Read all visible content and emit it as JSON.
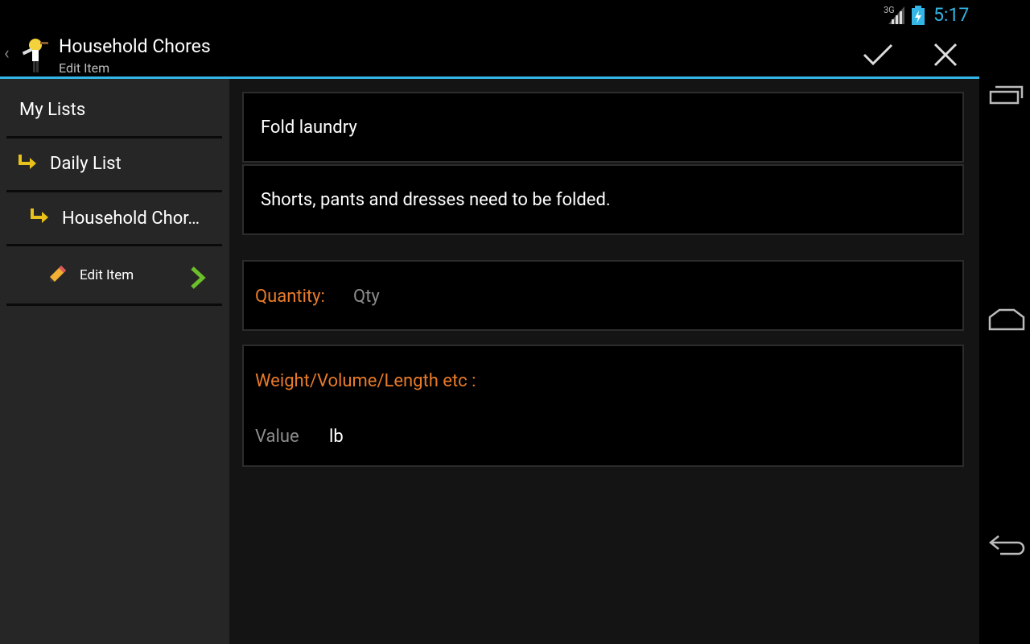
{
  "status_bar": {
    "network": "3G",
    "time": "5:17"
  },
  "action_bar": {
    "title": "Household Chores",
    "subtitle": "Edit Item"
  },
  "sidebar": {
    "items": [
      {
        "label": "My Lists"
      },
      {
        "label": "Daily List"
      },
      {
        "label": "Household Chor…"
      },
      {
        "label": "Edit Item"
      }
    ]
  },
  "form": {
    "item_name": "Fold laundry",
    "item_notes": "Shorts, pants and dresses need to be folded.",
    "quantity_label": "Quantity:",
    "quantity_placeholder": "Qty",
    "measure_label": "Weight/Volume/Length etc :",
    "value_placeholder": "Value",
    "unit": "lb"
  },
  "colors": {
    "accent": "#33b5e5",
    "label_orange": "#e87b2a",
    "nav_arrow": "#6abf2a",
    "tree_arrow": "#e8c21a"
  }
}
